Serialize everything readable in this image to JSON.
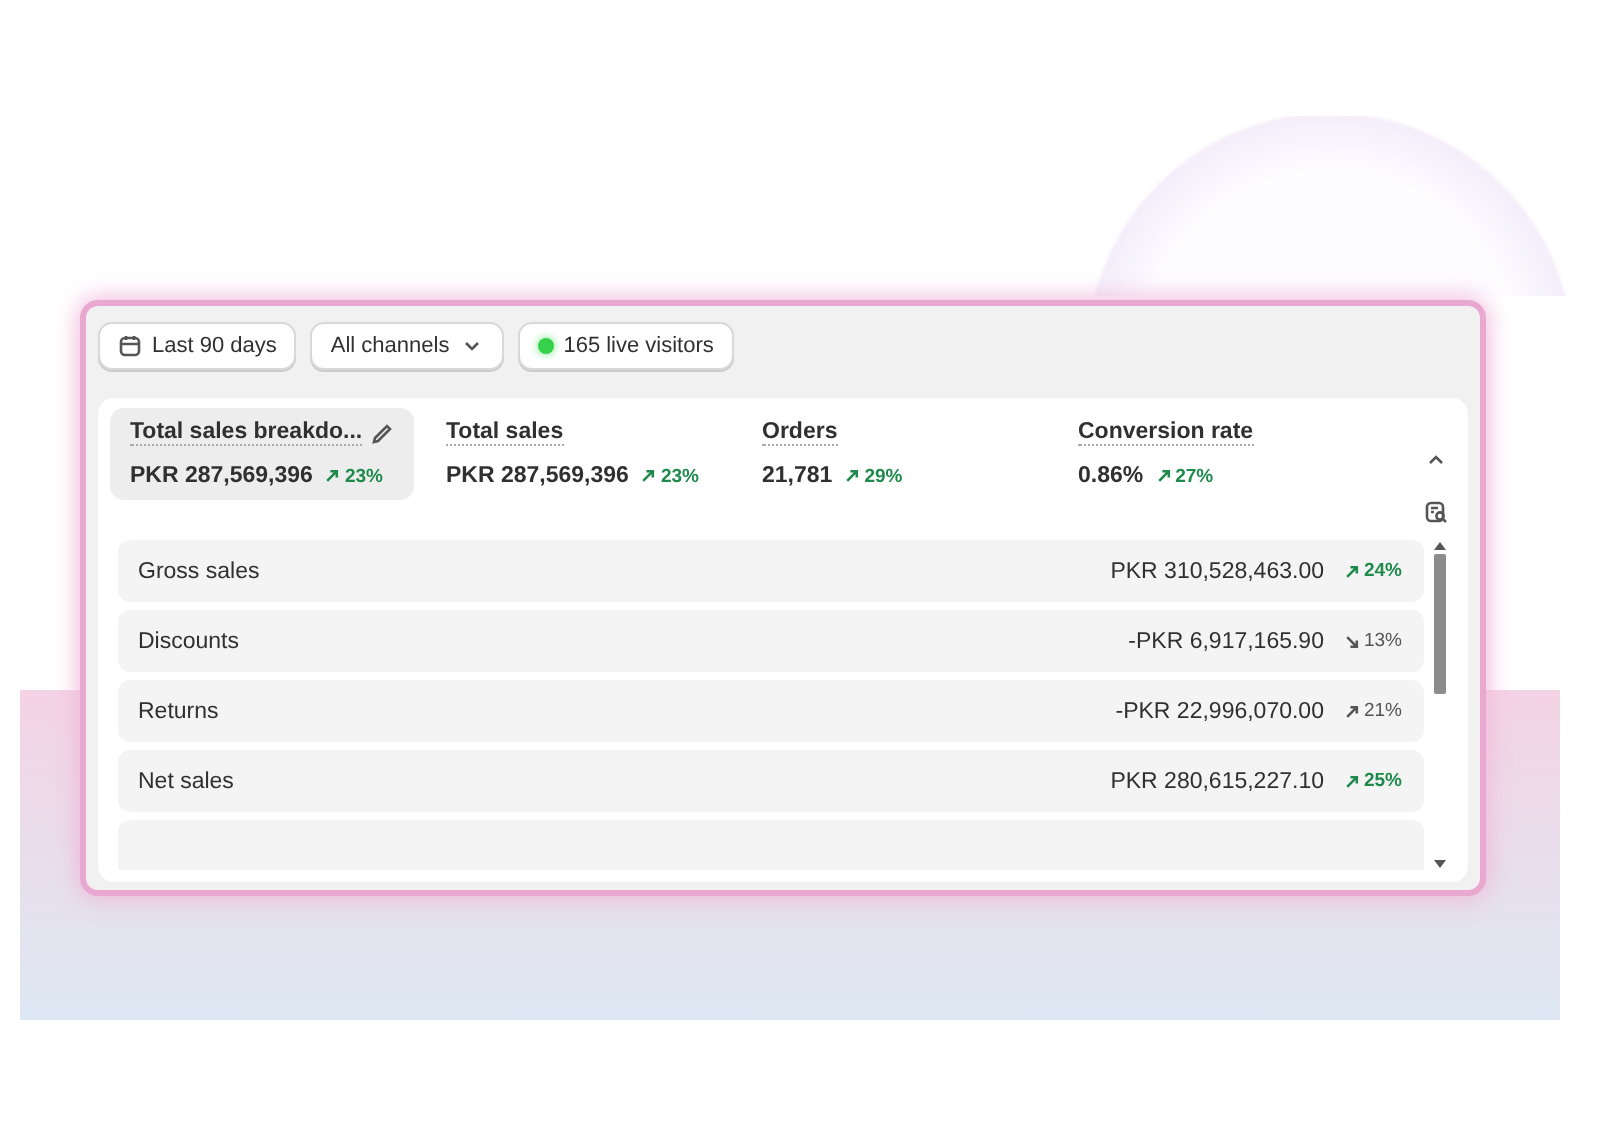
{
  "filters": [
    {
      "kind": "date",
      "label": "Last 90 days"
    },
    {
      "kind": "dropdown",
      "label": "All channels"
    },
    {
      "kind": "live",
      "label": "165 live visitors"
    }
  ],
  "metrics": [
    {
      "label": "Total sales breakdo...",
      "value": "PKR 287,569,396",
      "change": "23%",
      "trend_up": true,
      "good": true,
      "selected": true
    },
    {
      "label": "Total sales",
      "value": "PKR 287,569,396",
      "change": "23%",
      "trend_up": true,
      "good": true,
      "selected": false
    },
    {
      "label": "Orders",
      "value": "21,781",
      "change": "29%",
      "trend_up": true,
      "good": true,
      "selected": false
    },
    {
      "label": "Conversion rate",
      "value": "0.86%",
      "change": "27%",
      "trend_up": true,
      "good": true,
      "selected": false
    }
  ],
  "breakdown": [
    {
      "label": "Gross sales",
      "value": "PKR 310,528,463.00",
      "change": "24%",
      "trend_up": true,
      "good": true
    },
    {
      "label": "Discounts",
      "value": "-PKR 6,917,165.90",
      "change": "13%",
      "trend_up": false,
      "good": false
    },
    {
      "label": "Returns",
      "value": "-PKR 22,996,070.00",
      "change": "21%",
      "trend_up": true,
      "good": false
    },
    {
      "label": "Net sales",
      "value": "PKR 280,615,227.10",
      "change": "25%",
      "trend_up": true,
      "good": true
    }
  ]
}
